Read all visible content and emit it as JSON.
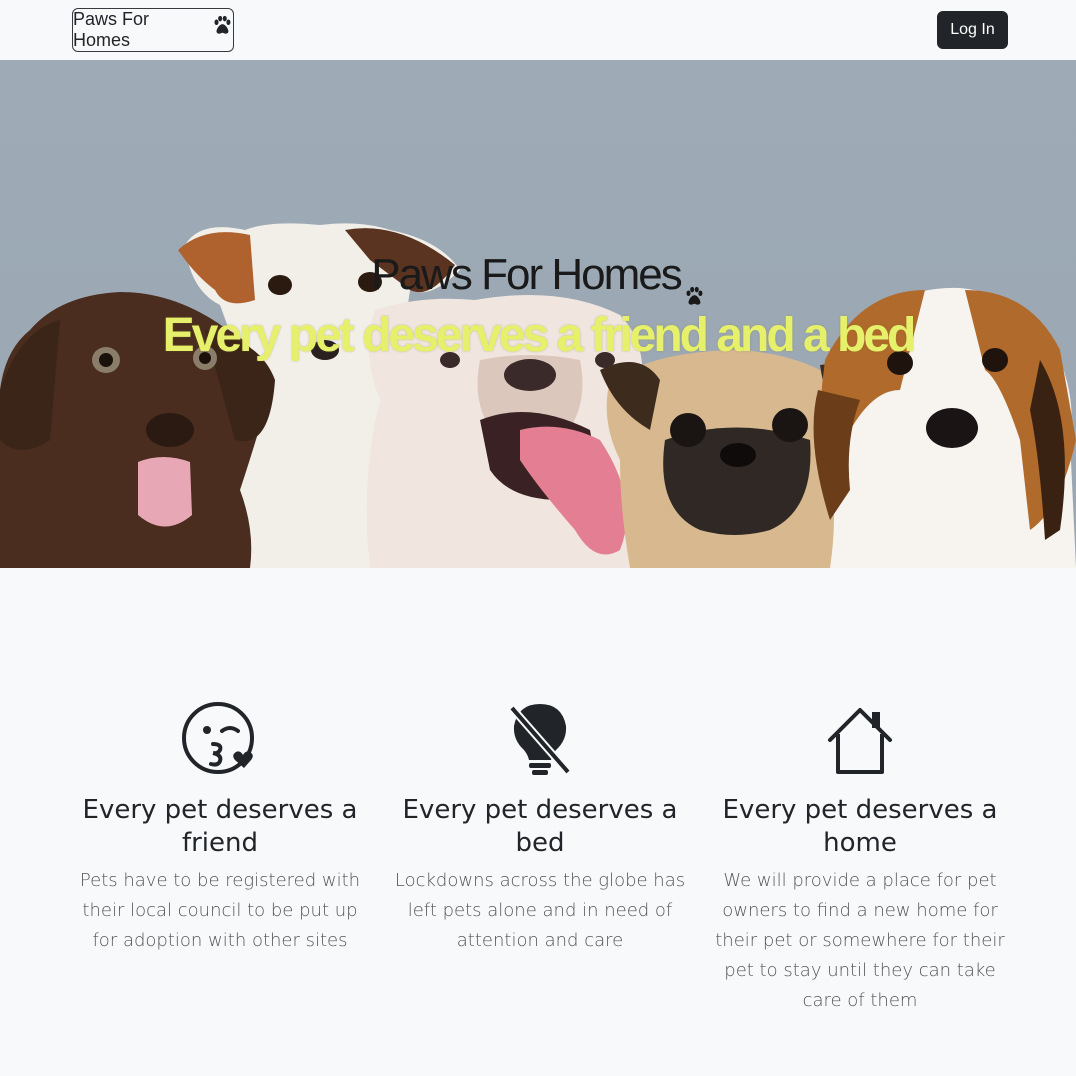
{
  "navbar": {
    "brand_label": "Paws For Homes",
    "brand_icon": "paw-icon",
    "login_label": "Log In"
  },
  "hero": {
    "title": "Paws For Homes",
    "title_icon": "paw-icon",
    "subtitle": "Every pet deserves a friend and a bed",
    "subtitle_color": "#e6f06a"
  },
  "features": [
    {
      "icon": "kissing-face-icon",
      "heading": "Every pet deserves a friend",
      "text": "Pets have to be registered with their local council to be put up for adoption with other sites"
    },
    {
      "icon": "lightbulb-off-icon",
      "heading": "Every pet deserves a bed",
      "text": "Lockdowns across the globe has left pets alone and in need of attention and care"
    },
    {
      "icon": "house-icon",
      "heading": "Every pet deserves a home",
      "text": "We will provide a place for pet owners to find a new home for their pet or somewhere for their pet to stay until they can take care of them"
    }
  ]
}
